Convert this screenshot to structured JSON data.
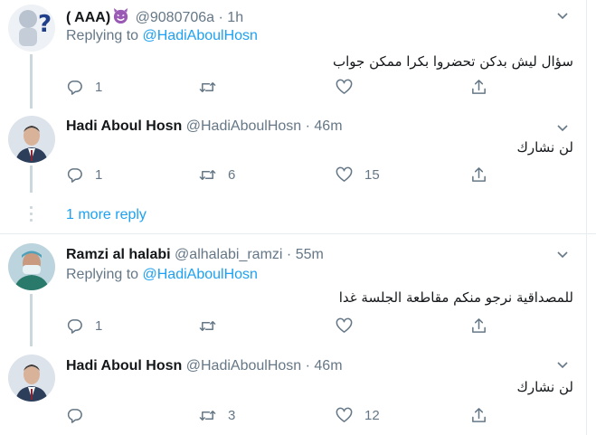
{
  "tweets": [
    {
      "name": "( AAA)",
      "emoji": "smiling-devil",
      "handle": "@9080706a",
      "sep": "·",
      "time": "1h",
      "replying_prefix": "Replying to ",
      "replying_to": "@HadiAboulHosn",
      "text": "سؤال ليش بدكن تحضروا بكرا ممكن جواب",
      "replies": "1",
      "retweets": "",
      "likes": ""
    },
    {
      "name": "Hadi Aboul Hosn",
      "handle": "@HadiAboulHosn",
      "sep": "·",
      "time": "46m",
      "text": "لن نشارك",
      "replies": "1",
      "retweets": "6",
      "likes": "15"
    },
    {
      "name": "Ramzi al halabi",
      "handle": "@alhalabi_ramzi",
      "sep": "·",
      "time": "55m",
      "replying_prefix": "Replying to ",
      "replying_to": "@HadiAboulHosn",
      "text": "للمصداقية نرجو منكم مقاطعة الجلسة غدا",
      "replies": "1",
      "retweets": "",
      "likes": ""
    },
    {
      "name": "Hadi Aboul Hosn",
      "handle": "@HadiAboulHosn",
      "sep": "·",
      "time": "46m",
      "text": "لن نشارك",
      "replies": "",
      "retweets": "3",
      "likes": "12"
    }
  ],
  "more_reply": "1 more reply",
  "colors": {
    "accent": "#1da1f2",
    "muted": "#657786",
    "thread_line": "#ccd6dd",
    "divider": "#e6ecf0",
    "devil_emoji": "#9b59b6"
  },
  "icons": [
    "chevron-down-icon",
    "reply-icon",
    "retweet-icon",
    "like-icon",
    "share-icon",
    "smiling-devil-emoji"
  ]
}
